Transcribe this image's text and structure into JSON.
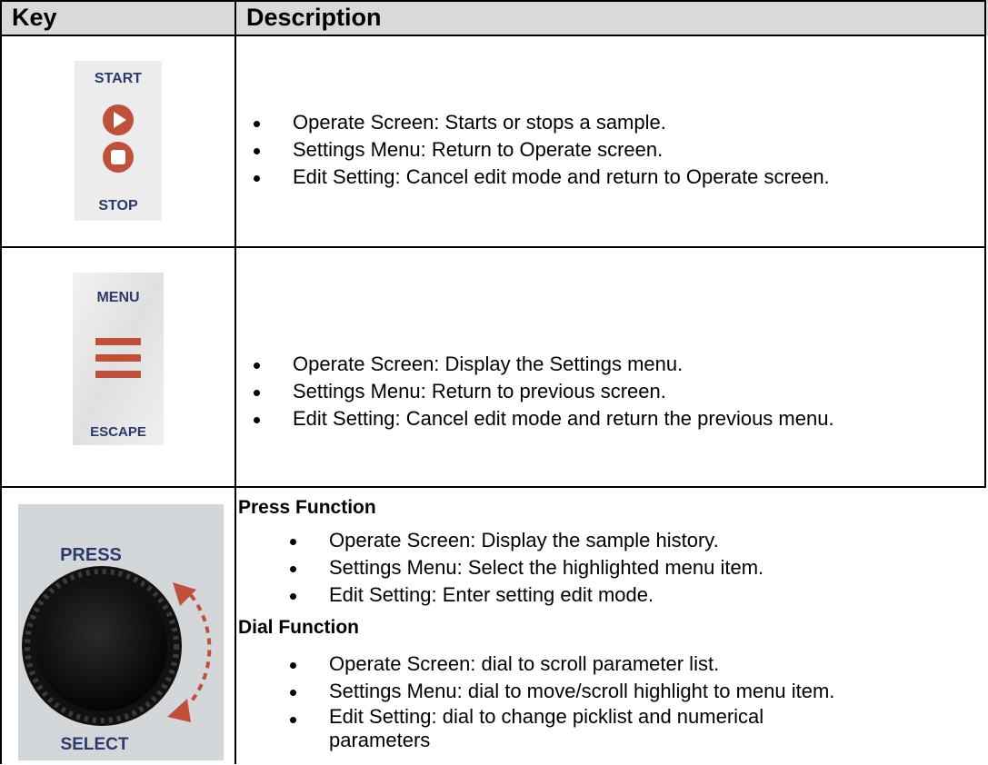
{
  "header": {
    "key_label": "Key",
    "description_label": "Description"
  },
  "rows": [
    {
      "key": {
        "top_label": "START",
        "bottom_label": "STOP"
      },
      "items": [
        "Operate Screen: Starts or stops a sample.",
        "Settings Menu: Return to Operate screen.",
        "Edit Setting: Cancel edit mode and return to Operate screen."
      ]
    },
    {
      "key": {
        "top_label": "MENU",
        "bottom_label": "ESCAPE"
      },
      "items": [
        "Operate Screen: Display the Settings menu.",
        "Settings Menu: Return to previous screen.",
        "Edit Setting: Cancel edit mode and return the previous menu."
      ]
    },
    {
      "key": {
        "top_label": "PRESS",
        "bottom_label": "SELECT"
      },
      "sections": [
        {
          "title": "Press Function",
          "items": [
            "Operate Screen: Display the sample history.",
            "Settings Menu: Select the highlighted menu item.",
            "Edit Setting: Enter setting edit mode."
          ]
        },
        {
          "title": "Dial Function",
          "items": [
            "Operate Screen: dial to scroll parameter list.",
            "Settings Menu: dial to move/scroll highlight to menu item.",
            "Edit Setting: dial to change picklist and numerical parameters"
          ]
        }
      ]
    }
  ],
  "colors": {
    "accent": "#c0503a",
    "label": "#2b3a6b",
    "header_bg": "#d9d9d9"
  }
}
